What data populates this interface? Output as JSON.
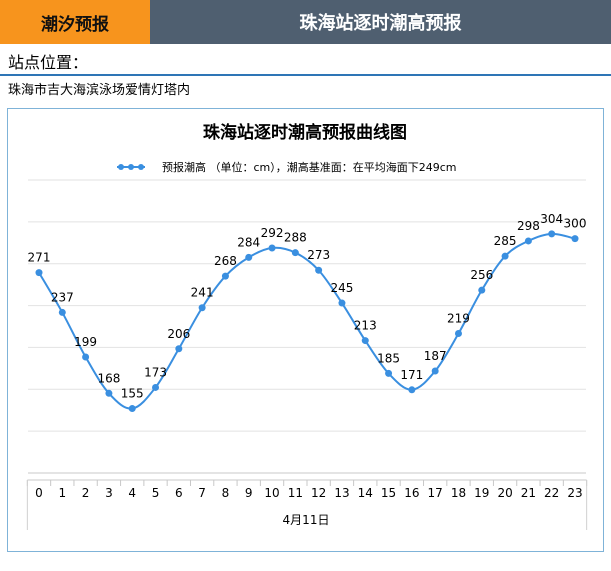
{
  "header": {
    "tab_label": "潮汐预报",
    "title": "珠海站逐时潮高预报"
  },
  "station": {
    "label": "站点位置：",
    "value": "珠海市吉大海滨泳场爱情灯塔内"
  },
  "colors": {
    "tab_orange": "#f7941d",
    "title_bar": "#4f5f70",
    "accent_blue": "#2e75b6",
    "series_line": "#3a8fe0"
  },
  "chart_data": {
    "type": "line",
    "title": "珠海站逐时潮高预报曲线图",
    "legend": "预报潮高 （单位：cm），潮高基准面：在平均海面下249cm",
    "legend_position": "top",
    "xlabel": "4月11日",
    "ylabel": "",
    "grid": true,
    "x": [
      0,
      1,
      2,
      3,
      4,
      5,
      6,
      7,
      8,
      9,
      10,
      11,
      12,
      13,
      14,
      15,
      16,
      17,
      18,
      19,
      20,
      21,
      22,
      23
    ],
    "series": [
      {
        "name": "预报潮高",
        "values": [
          271,
          237,
          199,
          168,
          155,
          173,
          206,
          241,
          268,
          284,
          292,
          288,
          273,
          245,
          213,
          185,
          171,
          187,
          219,
          256,
          285,
          298,
          304,
          300
        ]
      }
    ]
  }
}
